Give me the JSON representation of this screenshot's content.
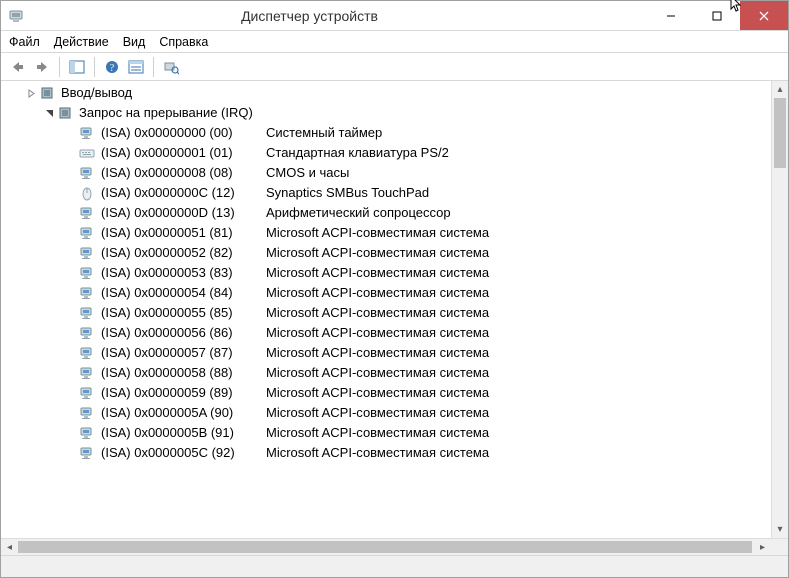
{
  "window": {
    "title": "Диспетчер устройств"
  },
  "menu": {
    "file": "Файл",
    "action": "Действие",
    "view": "Вид",
    "help": "Справка"
  },
  "tree": {
    "io_node": {
      "label": "Ввод/вывод",
      "expanded": false
    },
    "irq_node": {
      "label": "Запрос на прерывание (IRQ)",
      "expanded": true,
      "items": [
        {
          "addr": "(ISA) 0x00000000 (00)",
          "desc": "Системный таймер",
          "icon": "computer"
        },
        {
          "addr": "(ISA) 0x00000001 (01)",
          "desc": "Стандартная клавиатура PS/2",
          "icon": "keyboard"
        },
        {
          "addr": "(ISA) 0x00000008 (08)",
          "desc": "CMOS и часы",
          "icon": "computer"
        },
        {
          "addr": "(ISA) 0x0000000C (12)",
          "desc": "Synaptics SMBus TouchPad",
          "icon": "mouse"
        },
        {
          "addr": "(ISA) 0x0000000D (13)",
          "desc": " Арифметический сопроцессор",
          "icon": "computer"
        },
        {
          "addr": "(ISA) 0x00000051 (81)",
          "desc": "Microsoft ACPI-совместимая система",
          "icon": "computer"
        },
        {
          "addr": "(ISA) 0x00000052 (82)",
          "desc": "Microsoft ACPI-совместимая система",
          "icon": "computer"
        },
        {
          "addr": "(ISA) 0x00000053 (83)",
          "desc": "Microsoft ACPI-совместимая система",
          "icon": "computer"
        },
        {
          "addr": "(ISA) 0x00000054 (84)",
          "desc": "Microsoft ACPI-совместимая система",
          "icon": "computer"
        },
        {
          "addr": "(ISA) 0x00000055 (85)",
          "desc": "Microsoft ACPI-совместимая система",
          "icon": "computer"
        },
        {
          "addr": "(ISA) 0x00000056 (86)",
          "desc": "Microsoft ACPI-совместимая система",
          "icon": "computer"
        },
        {
          "addr": "(ISA) 0x00000057 (87)",
          "desc": "Microsoft ACPI-совместимая система",
          "icon": "computer"
        },
        {
          "addr": "(ISA) 0x00000058 (88)",
          "desc": "Microsoft ACPI-совместимая система",
          "icon": "computer"
        },
        {
          "addr": "(ISA) 0x00000059 (89)",
          "desc": "Microsoft ACPI-совместимая система",
          "icon": "computer"
        },
        {
          "addr": "(ISA) 0x0000005A (90)",
          "desc": " Microsoft ACPI-совместимая система",
          "icon": "computer"
        },
        {
          "addr": "(ISA) 0x0000005B (91)",
          "desc": "Microsoft ACPI-совместимая система",
          "icon": "computer"
        },
        {
          "addr": "(ISA) 0x0000005C (92)",
          "desc": "Microsoft ACPI-совместимая система",
          "icon": "computer"
        }
      ]
    }
  }
}
